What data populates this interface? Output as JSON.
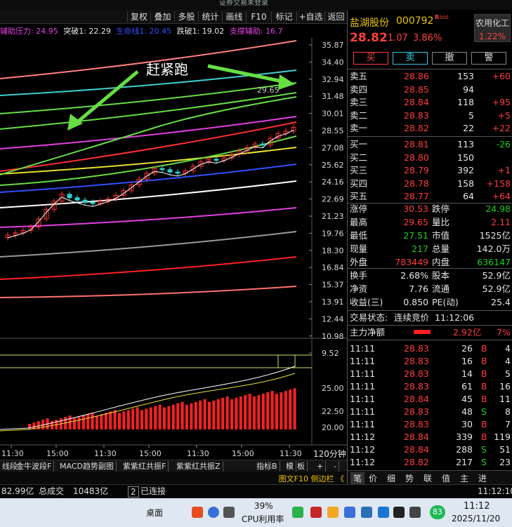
{
  "window": {
    "title_left": "",
    "title_center": "证券交易未登录"
  },
  "toolbar": {
    "items": [
      "复权",
      "叠加",
      "多股",
      "统计",
      "画线",
      "F10",
      "标记",
      "+自选",
      "返回"
    ]
  },
  "legend": [
    {
      "text": "辅助压力: 24.95",
      "color": "#e040e0"
    },
    {
      "text": "突破1: 22.29",
      "color": "#e6e6e6"
    },
    {
      "text": "生命线1: 20.45",
      "color": "#3050ff"
    },
    {
      "text": "跌破1: 19.02",
      "color": "#e6e6e6"
    },
    {
      "text": "支撑辅助: 16.7",
      "color": "#e040e0"
    }
  ],
  "annotation": {
    "text": "赶紧跑",
    "high_label": "29.65"
  },
  "axis": {
    "price_ticks": [
      "35.87",
      "34.40",
      "32.94",
      "31.48",
      "30.01",
      "28.55",
      "27.08",
      "25.62",
      "24.16",
      "22.69",
      "21.23",
      "19.76",
      "18.30",
      "16.84",
      "15.37",
      "13.91",
      "12.44",
      "10.98",
      "9.52"
    ],
    "sub_ticks": [
      "25.00",
      "22.50",
      "20.00"
    ],
    "x_ticks": [
      "11:30",
      "15:00",
      "11:30",
      "15:00",
      "11:30",
      "15:00",
      "11:30"
    ],
    "period": "120分钟"
  },
  "chart_data": {
    "type": "line",
    "title": "",
    "xlabel": "",
    "ylabel": "",
    "ylim": [
      9.52,
      35.87
    ],
    "x": [
      "11:30",
      "15:00",
      "11:30",
      "15:00",
      "11:30",
      "15:00",
      "11:30"
    ],
    "series": [
      {
        "name": "辅助压力",
        "values": [
          24.95
        ]
      },
      {
        "name": "突破1",
        "values": [
          22.29
        ]
      },
      {
        "name": "生命线1",
        "values": [
          20.45
        ]
      },
      {
        "name": "跌破1",
        "values": [
          19.02
        ]
      },
      {
        "name": "支撑辅助",
        "values": [
          16.7
        ]
      }
    ],
    "candles_close": [
      19.6,
      19.8,
      20.0,
      20.3,
      21.0,
      21.8,
      22.5,
      23.1,
      22.8,
      22.6,
      22.4,
      22.3,
      22.5,
      22.7,
      23.0,
      23.4,
      23.9,
      24.4,
      24.9,
      25.3,
      25.2,
      25.0,
      24.9,
      25.1,
      25.5,
      25.9,
      26.1,
      26.0,
      26.2,
      26.5,
      26.8,
      27.1,
      27.4,
      27.3,
      27.9,
      28.3,
      28.5,
      28.82
    ]
  },
  "tabs": [
    "线段",
    "金牛波段F",
    "MACD趋势副图",
    "紫紫红共振F",
    "紫紫红共振Z",
    "指标B",
    "模",
    "板",
    "+",
    "-"
  ],
  "f10bar": {
    "text": "图文F10  侧边栏 《"
  },
  "status": {
    "vol": "82.99亿",
    "total_label": "总成交",
    "total": "10483亿",
    "num": "2",
    "connected": "已连接",
    "time": "11:12:10"
  },
  "stock": {
    "name": "盐湖股份",
    "code": "000792",
    "r_mark": "R",
    "r_num": "300",
    "sector": "农用化工",
    "sector_pct": "1.22%",
    "price": "28.82",
    "change": "1.07",
    "pct": "3.86%"
  },
  "buttons": {
    "buy": "买",
    "sell": "卖",
    "cancel": "撤",
    "alert": "警"
  },
  "asks": [
    {
      "label": "卖五",
      "price": "28.86",
      "vol": "153",
      "chg": "+60"
    },
    {
      "label": "卖四",
      "price": "28.85",
      "vol": "94",
      "chg": ""
    },
    {
      "label": "卖三",
      "price": "28.84",
      "vol": "118",
      "chg": "+95"
    },
    {
      "label": "卖二",
      "price": "28.83",
      "vol": "5",
      "chg": "+5"
    },
    {
      "label": "卖一",
      "price": "28.82",
      "vol": "22",
      "chg": "+22"
    }
  ],
  "bids": [
    {
      "label": "买一",
      "price": "28.81",
      "vol": "113",
      "chg": "-26"
    },
    {
      "label": "买二",
      "price": "28.80",
      "vol": "150",
      "chg": ""
    },
    {
      "label": "买三",
      "price": "28.79",
      "vol": "392",
      "chg": "+1"
    },
    {
      "label": "买四",
      "price": "28.78",
      "vol": "158",
      "chg": "+158"
    },
    {
      "label": "买五",
      "price": "28.77",
      "vol": "64",
      "chg": "+64"
    }
  ],
  "stats": [
    {
      "l1": "涨停",
      "v1": "30.53",
      "l2": "跌停",
      "v2": "24.98"
    },
    {
      "l1": "最高",
      "v1": "29.65",
      "l2": "量比",
      "v2": "2.11"
    },
    {
      "l1": "最低",
      "v1": "27.51",
      "l2": "市值",
      "v2": "1525亿"
    },
    {
      "l1": "现量",
      "v1": "217",
      "l2": "总量",
      "v2": "142.0万"
    },
    {
      "l1": "外盘",
      "v1": "783449",
      "l2": "内盘",
      "v2": "636147"
    }
  ],
  "stats2": [
    {
      "l1": "换手",
      "v1": "2.68%",
      "l2": "股本",
      "v2": "52.9亿"
    },
    {
      "l1": "净资",
      "v1": "7.76",
      "l2": "流通",
      "v2": "52.9亿"
    },
    {
      "l1": "收益(三)",
      "v1": "0.850",
      "l2": "PE(动)",
      "v2": "25.4"
    }
  ],
  "trade_state": {
    "label": "交易状态:",
    "value": "连续竞价",
    "time": "11:12:06"
  },
  "main_flow": {
    "label": "主力净额",
    "value": "2.92亿",
    "pct": "7%"
  },
  "ticks": [
    {
      "t": "11:11",
      "p": "28.83",
      "v": "26",
      "s": "B",
      "n": "4"
    },
    {
      "t": "11:11",
      "p": "28.83",
      "v": "16",
      "s": "B",
      "n": "4"
    },
    {
      "t": "11:11",
      "p": "28.83",
      "v": "14",
      "s": "B",
      "n": "5"
    },
    {
      "t": "11:11",
      "p": "28.83",
      "v": "61",
      "s": "B",
      "n": "16"
    },
    {
      "t": "11:11",
      "p": "28.84",
      "v": "45",
      "s": "B",
      "n": "11"
    },
    {
      "t": "11:11",
      "p": "28.83",
      "v": "48",
      "s": "S",
      "n": "8"
    },
    {
      "t": "11:11",
      "p": "28.83",
      "v": "30",
      "s": "B",
      "n": "7"
    },
    {
      "t": "11:12",
      "p": "28.84",
      "v": "339",
      "s": "B",
      "n": "119"
    },
    {
      "t": "11:12",
      "p": "28.84",
      "v": "288",
      "s": "S",
      "n": "51"
    },
    {
      "t": "11:12",
      "p": "28.82",
      "v": "217",
      "s": "S",
      "n": "23"
    }
  ],
  "panel_tabs": [
    "笔",
    "价",
    "细",
    "势",
    "联",
    "值",
    "主",
    "进"
  ],
  "taskbar": {
    "desktop": "桌面",
    "cpu_pct": "39%",
    "cpu_label": "CPU利用率",
    "clock_time": "11:12",
    "clock_date": "2025/11/20",
    "badge": "83"
  }
}
